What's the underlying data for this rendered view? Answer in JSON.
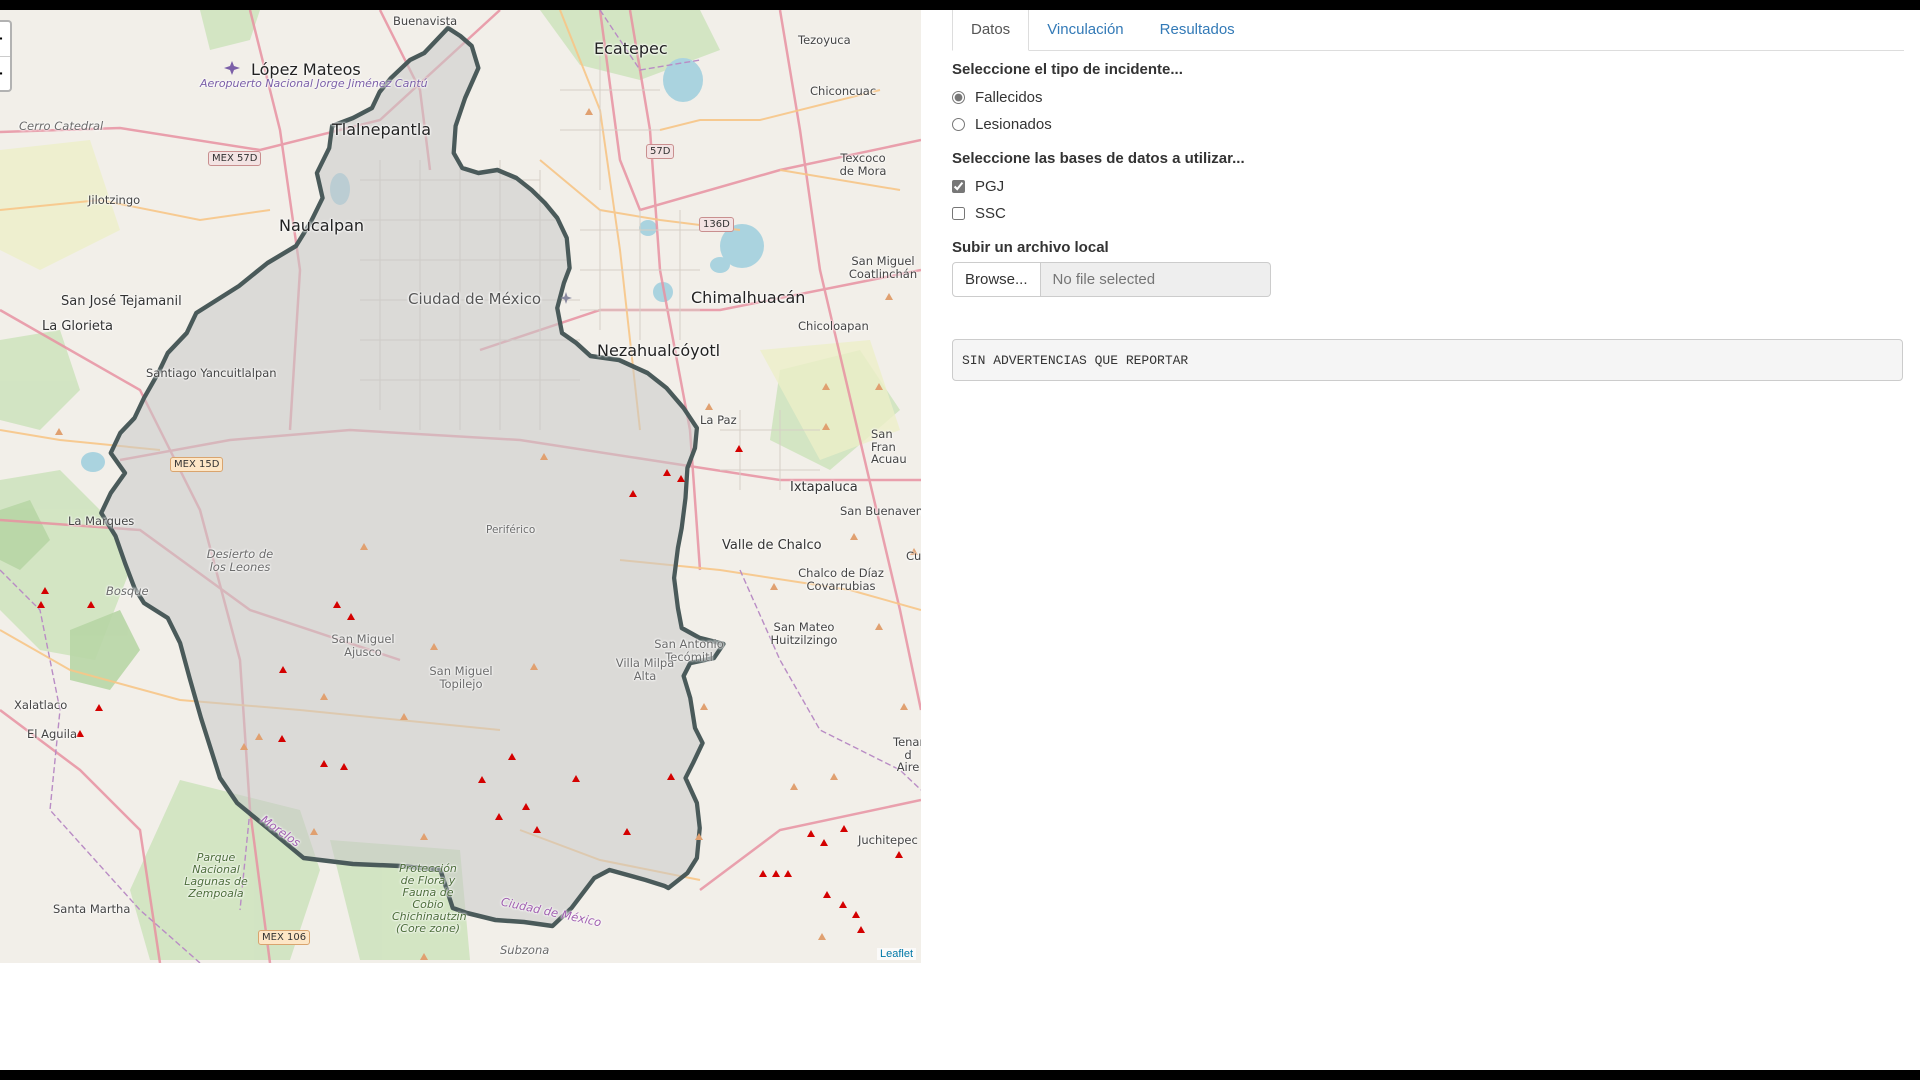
{
  "map": {
    "zoom_in": "+",
    "zoom_out": "−",
    "attribution": "Leaflet",
    "labels": {
      "buenavista": "Buenavista",
      "ecatepec": "Ecatepec",
      "tezoyuca": "Tezoyuca",
      "lopez_mateos": "López Mateos",
      "aeropuerto": "Aeropuerto Nacional Jorge Jiménez Cantú",
      "chiconcuac": "Chiconcuac",
      "cerro_catedral": "Cerro Catedral",
      "tlalnepantla": "Tlalnepantla",
      "texcoco": "Texcoco de Mora",
      "jilotzingo": "Jilotzingo",
      "naucalpan": "Naucalpan",
      "san_miguel_coatlinchan": "San Miguel Coatlinchán",
      "san_jose": "San José Tejamanil",
      "cdmx": "Ciudad de México",
      "chimalhuacan": "Chimalhuacán",
      "la_glorieta": "La Glorieta",
      "chicoloapan": "Chicoloapan",
      "nezahualcoyotl": "Nezahualcóyotl",
      "santiago": "Santiago Yancuitlalpan",
      "la_paz": "La Paz",
      "san_fran": "San Fran Acuau",
      "ixtapaluca": "Ixtapaluca",
      "la_marquesa": "La Marques",
      "san_buenaventura": "San Buenaven",
      "periferico": "Periférico",
      "desierto": "Desierto de los Leones",
      "valle_chalco": "Valle de Chalco",
      "bosque": "Bosque",
      "chalco": "Chalco de Díaz Covarrubias",
      "san_mateo": "San Mateo Huitzilzingo",
      "san_miguel_ajusco": "San Miguel Ajusco",
      "san_antonio": "San Antonio Tecómitl",
      "san_miguel_topilejo": "San Miguel Topilejo",
      "villa_milpa": "Villa Milpa Alta",
      "xalatlaco": "Xalatlaco",
      "el_aguila": "El Aguila",
      "tenango": "Tenango d Aire",
      "morelos": "Morelos",
      "juchitepec": "Juchitepec",
      "parque": "Parque Nacional Lagunas de Zempoala",
      "proteccion": "Protección de Flora y Fauna de Cobio Chichinautzin (Core zone)",
      "santa_martha": "Santa Martha",
      "ciudad_mexico_road": "Ciudad de México",
      "subzona": "Subzona",
      "cu": "Cu"
    },
    "shields": {
      "mex57d": "MEX 57D",
      "r57d": "57D",
      "r136d": "136D",
      "mex15d": "MEX 15D",
      "mex106": "MEX 106"
    },
    "colors": {
      "background": "#f2efe9",
      "forest": "#c8dfb8",
      "water": "#aad3df",
      "polygon_fill": "#c9c9c9",
      "polygon_stroke": "#4a5a5a",
      "major_road": "#e892a2",
      "secondary_road": "#f7c587",
      "peak": "#d40000"
    }
  },
  "panel": {
    "tabs": [
      {
        "label": "Datos",
        "active": true
      },
      {
        "label": "Vinculación",
        "active": false
      },
      {
        "label": "Resultados",
        "active": false
      }
    ],
    "incident_label": "Seleccione el tipo de incidente...",
    "incident_options": [
      {
        "label": "Fallecidos",
        "checked": true
      },
      {
        "label": "Lesionados",
        "checked": false
      }
    ],
    "databases_label": "Seleccione las bases de datos a utilizar...",
    "database_options": [
      {
        "label": "PGJ",
        "checked": true
      },
      {
        "label": "SSC",
        "checked": false
      }
    ],
    "upload_label": "Subir un archivo local",
    "browse_button": "Browse...",
    "file_placeholder": "No file selected",
    "warnings_text": "SIN ADVERTENCIAS QUE REPORTAR"
  }
}
